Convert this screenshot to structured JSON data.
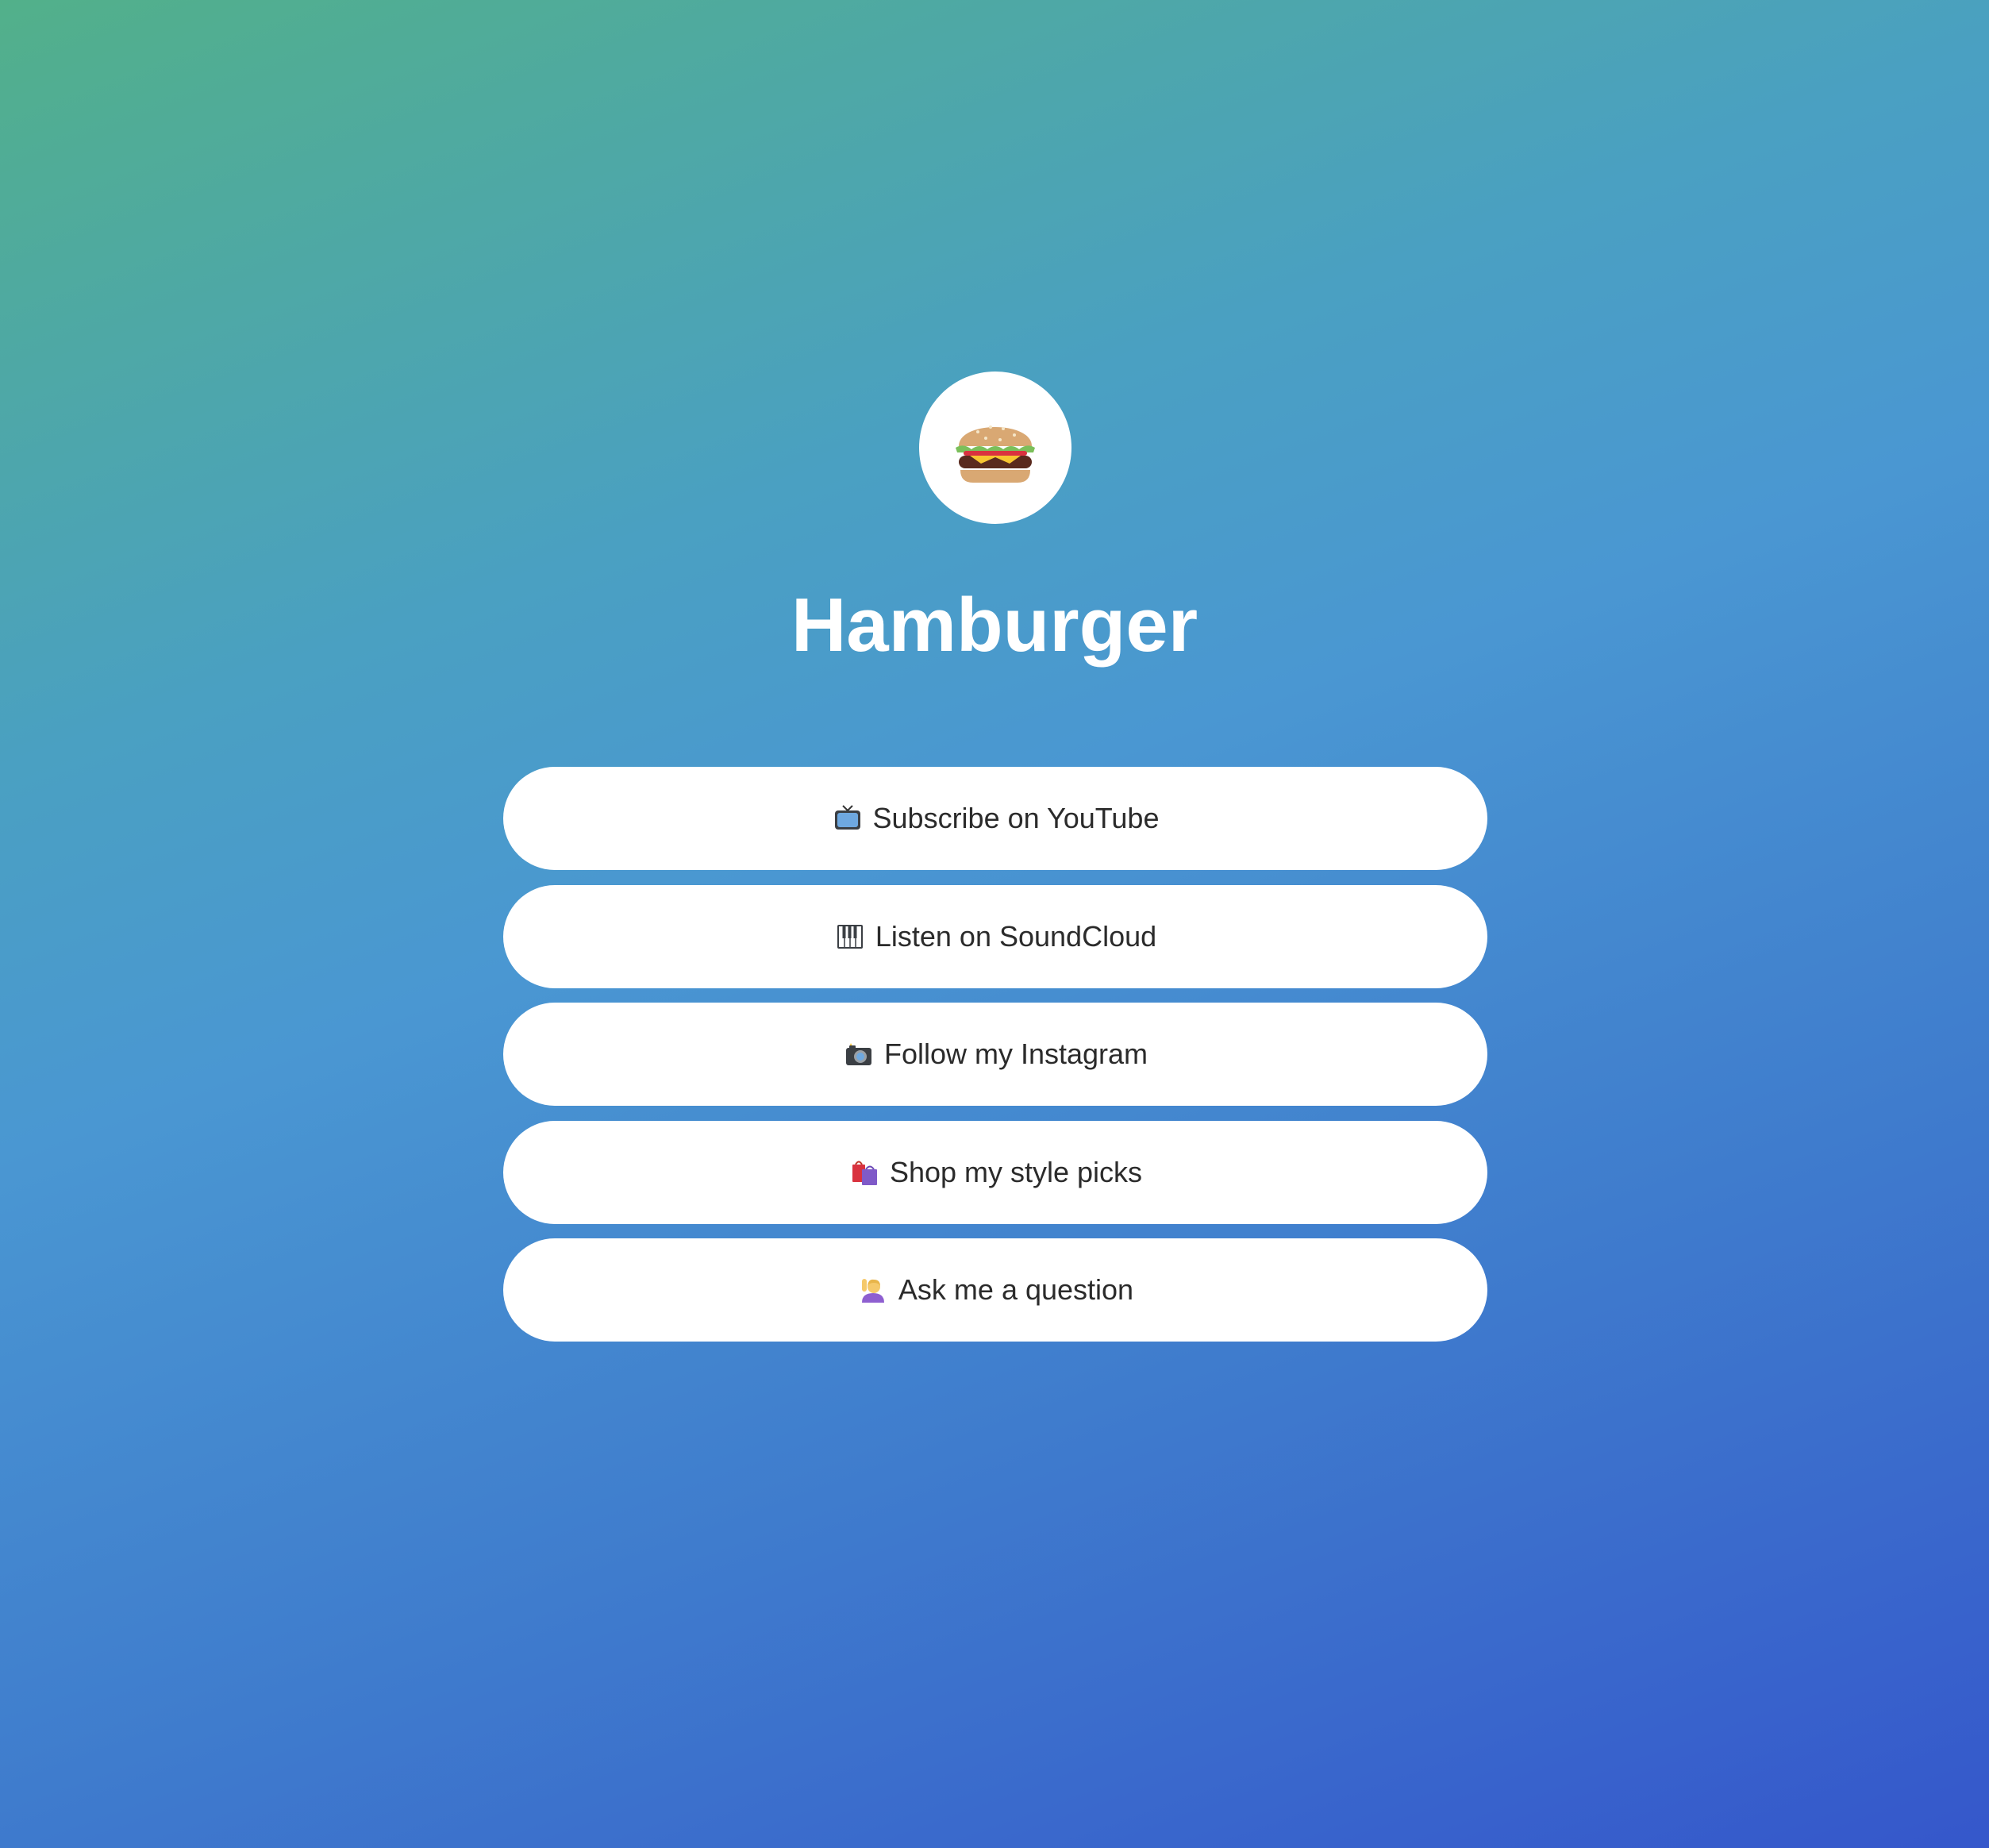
{
  "profile": {
    "avatar_icon": "hamburger-icon",
    "name": "Hamburger"
  },
  "links": [
    {
      "icon": "television-icon",
      "label": "Subscribe on YouTube"
    },
    {
      "icon": "piano-keys-icon",
      "label": "Listen on SoundCloud"
    },
    {
      "icon": "camera-flash-icon",
      "label": "Follow my Instagram"
    },
    {
      "icon": "shopping-bags-icon",
      "label": "Shop my style picks"
    },
    {
      "icon": "person-raising-hand-icon",
      "label": "Ask me a question"
    }
  ],
  "colors": {
    "gradient_start": "#52b08a",
    "gradient_mid": "#4a97d2",
    "gradient_end": "#3557cb",
    "button_bg": "#ffffff",
    "button_text": "#2b2b2b",
    "title_text": "#ffffff"
  }
}
